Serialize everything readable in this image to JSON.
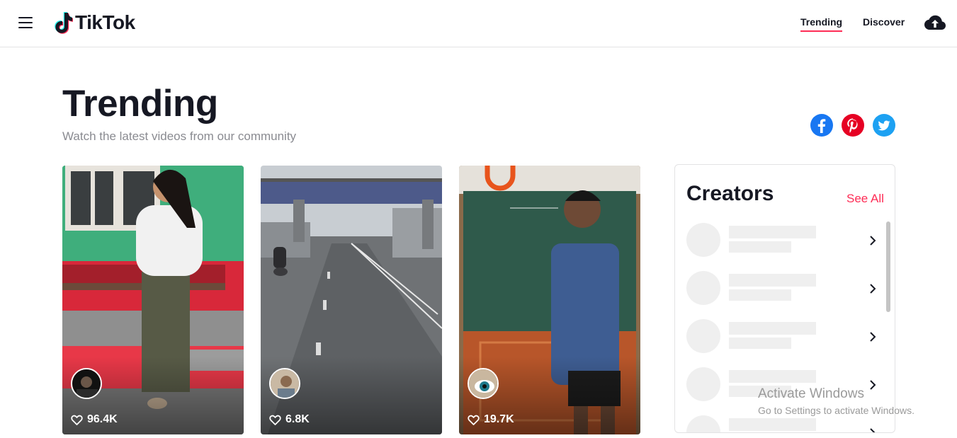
{
  "header": {
    "logo_text": "TikTok",
    "nav": [
      {
        "label": "Trending",
        "active": true
      },
      {
        "label": "Discover",
        "active": false
      }
    ],
    "upload_icon": "cloud-upload-icon",
    "menu_icon": "hamburger-menu-icon"
  },
  "page": {
    "title": "Trending",
    "subtitle": "Watch the latest videos from our community"
  },
  "social": [
    {
      "name": "facebook-icon",
      "color": "#1877f2"
    },
    {
      "name": "pinterest-icon",
      "color": "#e60023"
    },
    {
      "name": "twitter-icon",
      "color": "#1da1f2"
    }
  ],
  "videos": [
    {
      "likes": "96.4K"
    },
    {
      "likes": "6.8K"
    },
    {
      "likes": "19.7K"
    }
  ],
  "creators": {
    "title": "Creators",
    "see_all": "See All"
  },
  "watermark": {
    "line1": "Activate Windows",
    "line2": "Go to Settings to activate Windows."
  },
  "colors": {
    "accent": "#fe2c55",
    "text": "#161823",
    "muted": "#8a8b91"
  }
}
